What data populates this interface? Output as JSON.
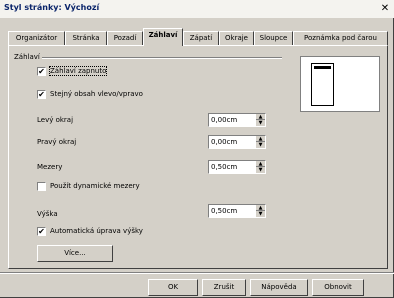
{
  "window": {
    "title": "Styl stránky: Výchozí",
    "close_glyph": "✕"
  },
  "tabs": [
    {
      "label": "Organizátor",
      "active": false
    },
    {
      "label": "Stránka",
      "active": false
    },
    {
      "label": "Pozadí",
      "active": false
    },
    {
      "label": "Záhlaví",
      "active": true
    },
    {
      "label": "Zápatí",
      "active": false
    },
    {
      "label": "Okraje",
      "active": false
    },
    {
      "label": "Sloupce",
      "active": false
    },
    {
      "label": "Poznámka pod čarou",
      "active": false
    }
  ],
  "header_group": {
    "label": "Záhlaví",
    "header_on": {
      "label": "Záhlaví zapnuto",
      "checked": true
    },
    "same_content": {
      "label": "Stejný obsah vlevo/vpravo",
      "checked": true
    },
    "left_margin": {
      "label": "Levý okraj",
      "value": "0,00cm"
    },
    "right_margin": {
      "label": "Pravý okraj",
      "value": "0,00cm"
    },
    "spacing": {
      "label": "Mezery",
      "value": "0,50cm"
    },
    "dynamic_spacing": {
      "label": "Použít dynamické mezery",
      "checked": false
    },
    "height": {
      "label": "Výška",
      "value": "0,50cm"
    },
    "autofit_height": {
      "label": "Automatická úprava výšky",
      "checked": true
    },
    "more_button": "Více..."
  },
  "footer_buttons": {
    "ok": "OK",
    "cancel": "Zrušit",
    "help": "Nápověda",
    "reset": "Obnovit"
  },
  "colors": {
    "dialog_bg": "#d4d0c8",
    "title_text": "#0a246a"
  }
}
